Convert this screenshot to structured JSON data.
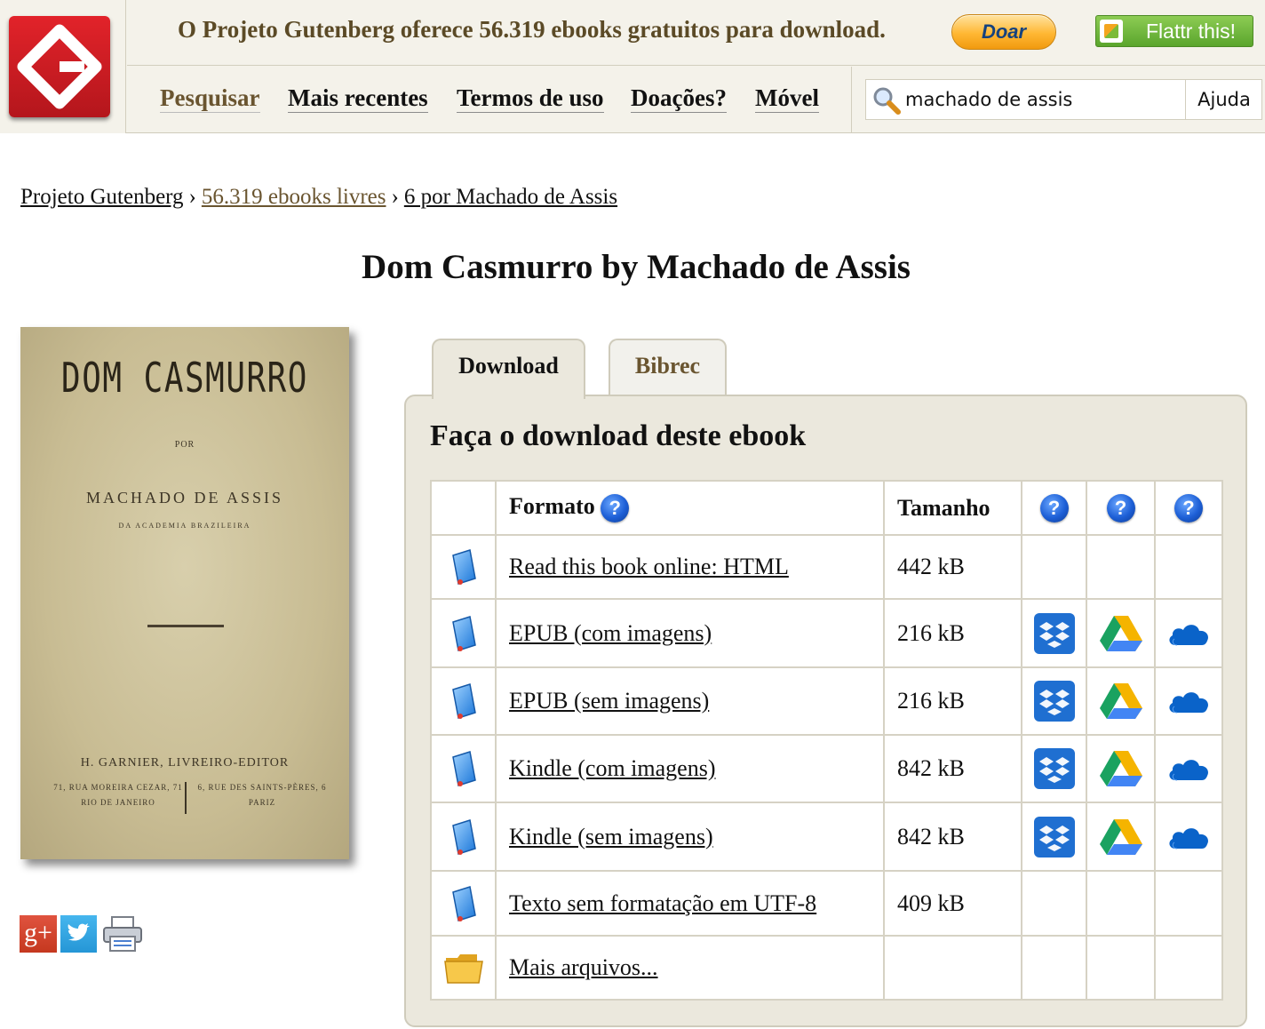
{
  "header": {
    "tagline": "O Projeto Gutenberg oferece 56.319 ebooks gratuitos para download.",
    "donate_label": "Doar",
    "flattr_label": "Flattr this!"
  },
  "nav": {
    "items": [
      {
        "label": "Pesquisar"
      },
      {
        "label": "Mais recentes"
      },
      {
        "label": "Termos de uso"
      },
      {
        "label": "Doações?"
      },
      {
        "label": "Móvel"
      }
    ]
  },
  "search": {
    "value": "machado de assis",
    "help_label": "Ajuda"
  },
  "breadcrumb": {
    "items": [
      "Projeto Gutenberg",
      "56.319 ebooks livres",
      "6 por Machado de Assis"
    ],
    "separator": "›"
  },
  "book": {
    "title": "Dom Casmurro by Machado de Assis"
  },
  "cover": {
    "title": "DOM CASMURRO",
    "por": "POR",
    "author": "MACHADO DE ASSIS",
    "academy": "DA ACADEMIA BRAZILEIRA",
    "publisher": "H. GARNIER, LIVREIRO-EDITOR",
    "address_left": [
      "71, RUA MOREIRA CEZAR, 71",
      "RIO DE JANEIRO"
    ],
    "address_right": [
      "6, RUE DES SAINTS-PÈRES, 6",
      "PARIZ"
    ]
  },
  "share": {
    "gplus_label": "g+"
  },
  "tabs": [
    {
      "label": "Download"
    },
    {
      "label": "Bibrec"
    }
  ],
  "download": {
    "heading": "Faça o download deste ebook",
    "columns": {
      "format": "Formato",
      "size": "Tamanho"
    },
    "rows": [
      {
        "icon": "book-icon",
        "format": "Read this book online: HTML",
        "size": "442 kB",
        "cloud": false
      },
      {
        "icon": "book-icon",
        "format": "EPUB (com imagens)",
        "size": "216 kB",
        "cloud": true
      },
      {
        "icon": "book-icon",
        "format": "EPUB (sem imagens)",
        "size": "216 kB",
        "cloud": true
      },
      {
        "icon": "book-icon",
        "format": "Kindle (com imagens)",
        "size": "842 kB",
        "cloud": true
      },
      {
        "icon": "book-icon",
        "format": "Kindle (sem imagens)",
        "size": "842 kB",
        "cloud": true
      },
      {
        "icon": "book-icon",
        "format": "Texto sem formatação em UTF-8",
        "size": "409 kB",
        "cloud": false
      },
      {
        "icon": "folder-icon",
        "format": "Mais arquivos...",
        "size": "",
        "cloud": false
      }
    ]
  },
  "colors": {
    "header_bg": "#f4f2ea",
    "panel_bg": "#ebe8dd",
    "tagline": "#5b4a26",
    "logo_red": "#d21f26"
  }
}
